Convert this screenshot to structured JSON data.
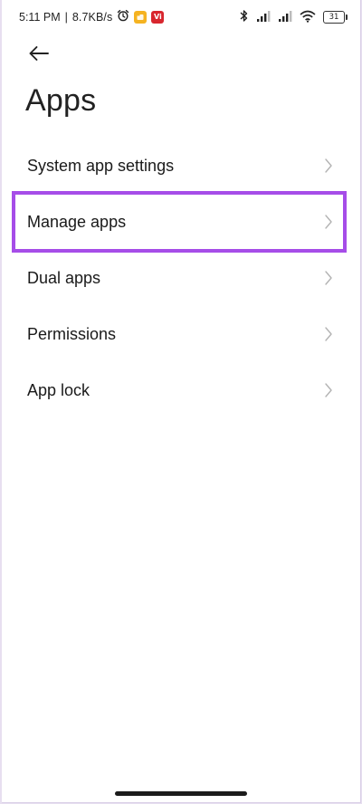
{
  "status_bar": {
    "time": "5:11 PM",
    "separator": "|",
    "speed": "8.7KB/s",
    "vi_badge": "Vi",
    "battery": "31",
    "icons": [
      "alarm-icon",
      "files-app-icon",
      "vi-app-icon",
      "bluetooth-icon",
      "signal-icon",
      "signal-icon",
      "wifi-icon",
      "battery-icon"
    ]
  },
  "header": {
    "back_icon": "arrow-left-icon",
    "title": "Apps"
  },
  "menu": {
    "items": [
      {
        "label": "System app settings"
      },
      {
        "label": "Manage apps"
      },
      {
        "label": "Dual apps"
      },
      {
        "label": "Permissions"
      },
      {
        "label": "App lock"
      }
    ],
    "chevron_icon": "chevron-right-icon"
  },
  "colors": {
    "highlight": "#a64de8",
    "background": "#ffffff",
    "text": "#1a1a1a",
    "chevron": "#b3b3b3"
  }
}
